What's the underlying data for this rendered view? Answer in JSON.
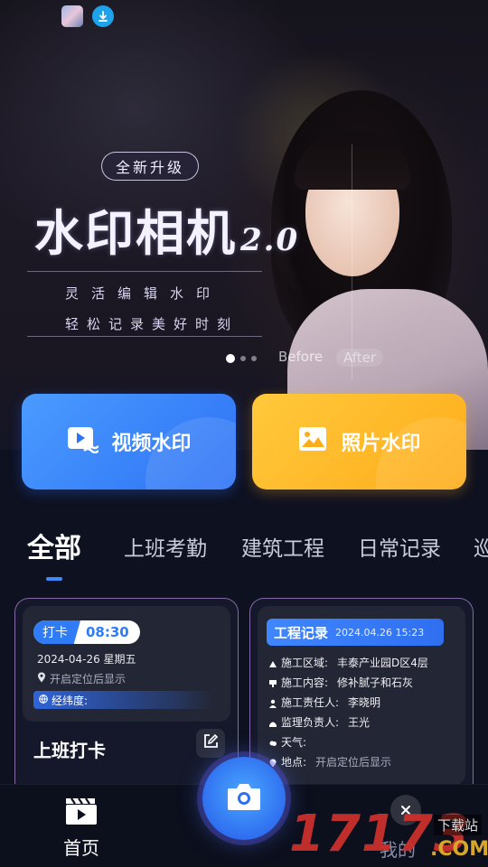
{
  "banner": {
    "badge": "全新升级",
    "title": "水印相机",
    "version": "2.0",
    "subtitle1": "灵活编辑水印",
    "subtitle2": "轻松记录美好时刻",
    "before_label": "Before",
    "after_label": "After",
    "slide_index": 1,
    "slide_count": 3
  },
  "actions": {
    "video_label": "视频水印",
    "photo_label": "照片水印"
  },
  "tabs": [
    {
      "label": "全部",
      "active": true
    },
    {
      "label": "上班考勤"
    },
    {
      "label": "建筑工程"
    },
    {
      "label": "日常记录"
    },
    {
      "label": "巡"
    }
  ],
  "card_punch": {
    "tag": "打卡",
    "time": "08:30",
    "date": "2024-04-26 星期五",
    "location": "开启定位后显示",
    "latlon_label": "经纬度:",
    "title": "上班打卡"
  },
  "card_record": {
    "tag": "工程记录",
    "timestamp": "2024.04.26 15:23",
    "rows": [
      {
        "key": "施工区域:",
        "value": "丰泰产业园D区4层"
      },
      {
        "key": "施工内容:",
        "value": "修补腻子和石灰"
      },
      {
        "key": "施工责任人:",
        "value": "李晓明"
      },
      {
        "key": "监理负责人:",
        "value": "王光"
      },
      {
        "key": "天气:",
        "value": ""
      },
      {
        "key": "地点:",
        "value": "开启定位后显示"
      }
    ]
  },
  "bottom_nav": {
    "home_label": "首页",
    "mine_label": "我的"
  },
  "watermark": {
    "number": "17173",
    "domain": ".COM",
    "tag": "下载站"
  },
  "colors": {
    "accent_blue": "#2f7cf6",
    "accent_orange": "#ffac1a",
    "background": "#0e1120"
  }
}
